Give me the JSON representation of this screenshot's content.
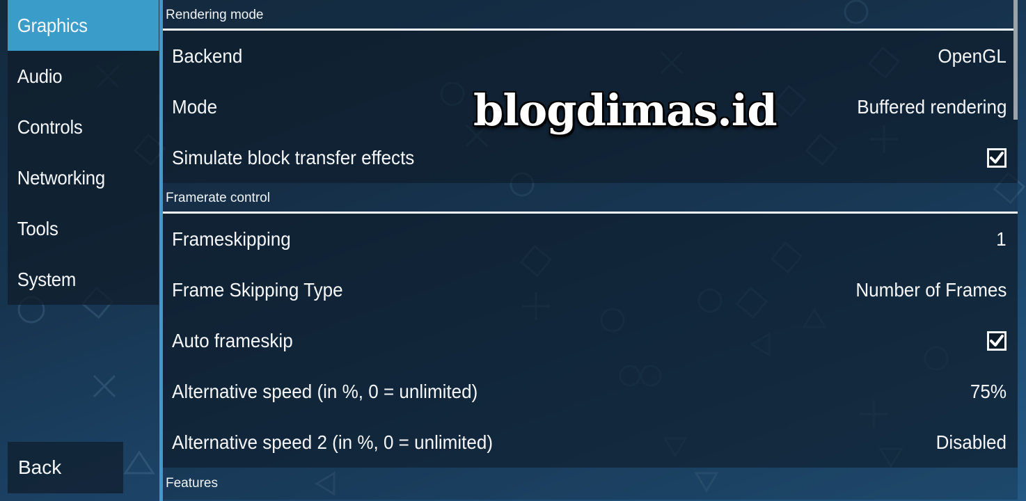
{
  "sidebar": {
    "items": [
      {
        "label": "Graphics",
        "active": true
      },
      {
        "label": "Audio",
        "active": false
      },
      {
        "label": "Controls",
        "active": false
      },
      {
        "label": "Networking",
        "active": false
      },
      {
        "label": "Tools",
        "active": false
      },
      {
        "label": "System",
        "active": false
      }
    ],
    "back_label": "Back"
  },
  "sections": {
    "rendering": {
      "title": "Rendering mode",
      "rows": [
        {
          "label": "Backend",
          "value": "OpenGL"
        },
        {
          "label": "Mode",
          "value": "Buffered rendering"
        },
        {
          "label": "Simulate block transfer effects",
          "checked": true
        }
      ]
    },
    "framerate": {
      "title": "Framerate control",
      "rows": [
        {
          "label": "Frameskipping",
          "value": "1"
        },
        {
          "label": "Frame Skipping Type",
          "value": "Number of Frames"
        },
        {
          "label": "Auto frameskip",
          "checked": true
        },
        {
          "label": "Alternative speed (in %, 0 = unlimited)",
          "value": "75%"
        },
        {
          "label": "Alternative speed 2 (in %, 0 = unlimited)",
          "value": "Disabled"
        }
      ]
    },
    "features": {
      "title": "Features"
    }
  },
  "watermark": "blogdimas.id",
  "colors": {
    "accent": "#3a9cc9",
    "panel": "#0e1c2a",
    "text": "#f4f6f8"
  }
}
